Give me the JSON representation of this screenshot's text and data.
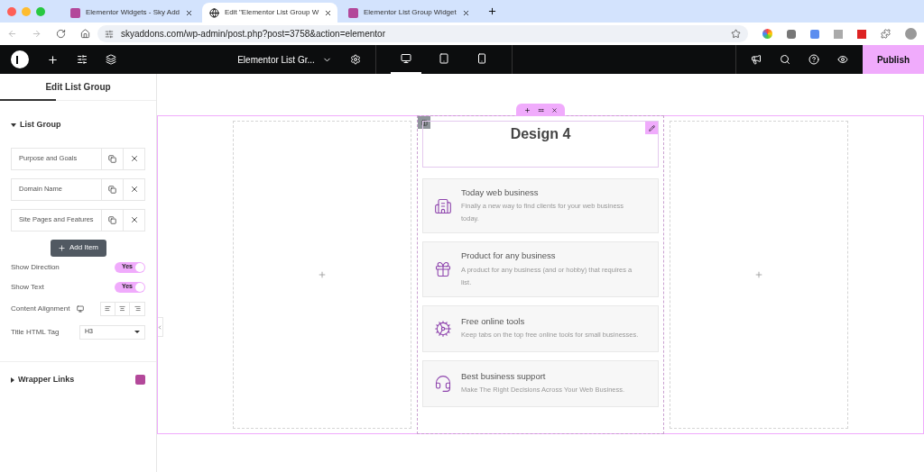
{
  "browser": {
    "tabs": [
      {
        "title": "Elementor Widgets - Sky Add",
        "selected": false,
        "kind": "sa"
      },
      {
        "title": "Edit \"Elementor List Group W",
        "selected": true,
        "kind": "globe"
      },
      {
        "title": "Elementor List Group Widget",
        "selected": false,
        "kind": "sa"
      }
    ],
    "url": "skyaddons.com/wp-admin/post.php?post=3758&action=elementor"
  },
  "editor_bar": {
    "page_title": "Elementor List Gr...",
    "devices": [
      {
        "kind": "desktop",
        "selected": true
      },
      {
        "kind": "tablet",
        "selected": false
      },
      {
        "kind": "mobile",
        "selected": false
      }
    ],
    "publish": "Publish"
  },
  "panel": {
    "title": "Edit List Group",
    "section": "List Group",
    "items": [
      "Purpose and Goals",
      "Domain Name",
      "Site Pages and Features"
    ],
    "add_item": "Add Item",
    "toggles": [
      {
        "label": "Show Direction",
        "on": true,
        "value": "Yes"
      },
      {
        "label": "Show Text",
        "on": true,
        "value": "Yes"
      }
    ],
    "alignment_label": "Content Alignment",
    "title_tag": {
      "label": "Title HTML Tag",
      "value": "H3"
    },
    "section2": "Wrapper Links"
  },
  "canvas": {
    "heading": "Design 4",
    "items": [
      {
        "kind": "building",
        "title": "Today web business",
        "text": "Finally a new way to find clients for your web business today."
      },
      {
        "kind": "gift",
        "title": "Product for any business",
        "text": "A product for any business (and or hobby) that requires a list."
      },
      {
        "kind": "gear",
        "title": "Free online tools",
        "text": "Keep tabs on the top free online tools for small businesses."
      },
      {
        "kind": "headset",
        "title": "Best business support",
        "text": "Make The Right Decisions Across Your Web Business."
      }
    ]
  }
}
